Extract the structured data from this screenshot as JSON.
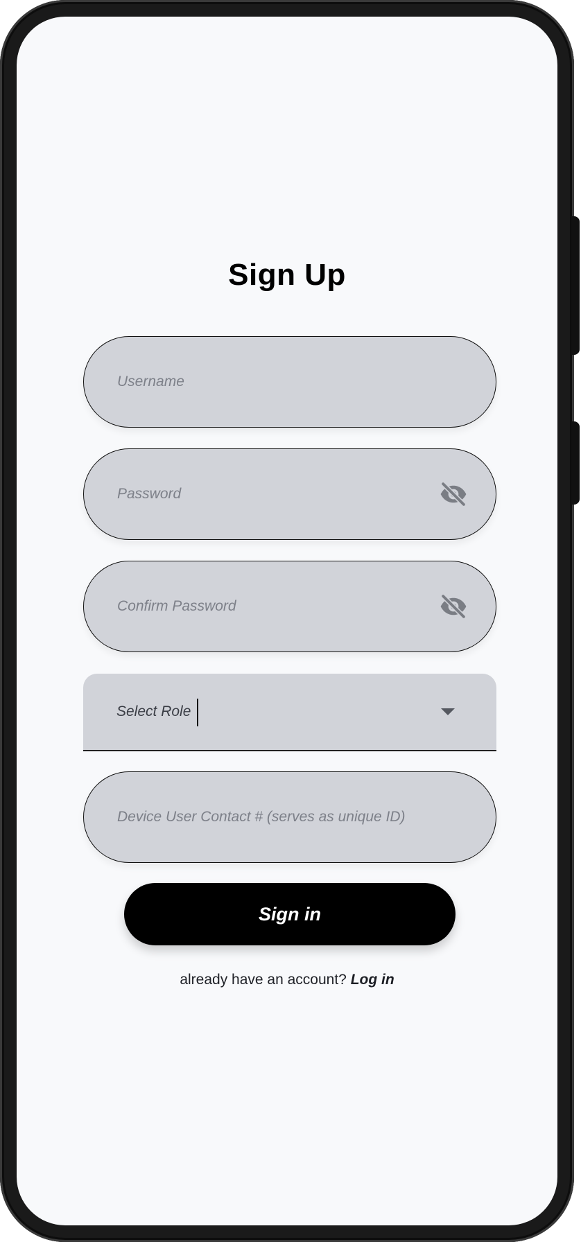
{
  "signup": {
    "title": "Sign Up",
    "username_placeholder": "Username",
    "password_placeholder": "Password",
    "confirm_password_placeholder": "Confirm Password",
    "role_label": "Select Role",
    "contact_placeholder": "Device User Contact # (serves as unique ID)",
    "submit_label": "Sign in",
    "footer_text": "already have an account?",
    "login_link_label": "Log in"
  },
  "icons": {
    "password_toggle": "eye-off-icon",
    "role_dropdown": "chevron-down-icon"
  },
  "colors": {
    "screen_background": "#f8f9fb",
    "field_background": "#d1d3d9",
    "placeholder_text": "#7d8089",
    "button_background": "#000000",
    "button_text": "#ffffff",
    "icon_gray": "#7a7d84"
  }
}
